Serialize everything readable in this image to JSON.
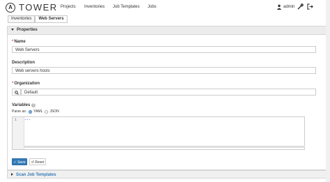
{
  "app": {
    "name": "TOWER",
    "logo_letter": "A"
  },
  "nav": {
    "items": [
      "Projects",
      "Inventories",
      "Job Templates",
      "Jobs"
    ],
    "user": "admin",
    "icons": [
      "user-icon",
      "wrench-icon",
      "logout-icon"
    ]
  },
  "breadcrumb": [
    "Inventories",
    "Web Servers"
  ],
  "properties": {
    "header": "Properties",
    "name_label": "Name",
    "name_value": "Web Servers",
    "description_label": "Description",
    "description_value": "Web servers hosts",
    "organization_label": "Organization",
    "organization_value": "Default",
    "variables_label": "Variables",
    "parse_as": "Parse as:",
    "parse_options": [
      "YAML",
      "JSON"
    ],
    "selected_parse": "YAML",
    "code_line_number": "1",
    "code": "---",
    "save": "Save",
    "reset": "Reset"
  },
  "section2": {
    "header": "Scan Job Templates"
  },
  "colors": {
    "accent": "#337ab7",
    "required": "#d9534f"
  }
}
